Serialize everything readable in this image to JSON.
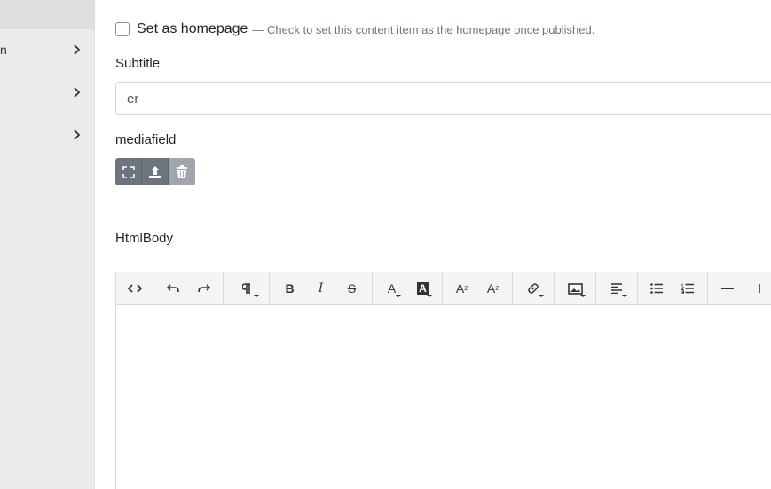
{
  "sidebar": {
    "items": [
      {
        "label": "n",
        "top": 0
      },
      {
        "label": "",
        "top": 0
      },
      {
        "label": "",
        "top": 0
      }
    ]
  },
  "form": {
    "homepage": {
      "label": "Set as homepage",
      "hint": "— Check to set this content item as the homepage once published."
    },
    "subtitle": {
      "label": "Subtitle",
      "value": "er"
    },
    "mediafield": {
      "label": "mediafield"
    },
    "htmlbody": {
      "label": "HtmlBody"
    }
  },
  "toolbar": {
    "bold": "B",
    "italic": "I",
    "strike": "S",
    "font_color": "A",
    "bg_color": "A",
    "superscript": "A",
    "subscript": "A"
  },
  "colors": {
    "sidebar_bg": "#ebebeb",
    "media_btn": "#6c757d",
    "media_btn_disabled": "#a0a6ab",
    "toolbar_bg": "#f3f4f4"
  }
}
